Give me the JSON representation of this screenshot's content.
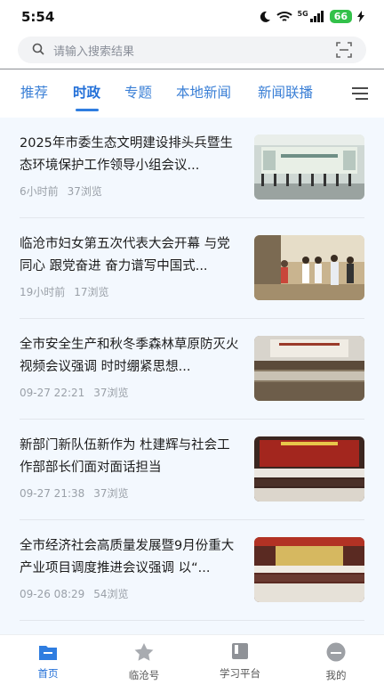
{
  "status": {
    "time": "5:54",
    "network": "5G",
    "battery": "66"
  },
  "search": {
    "placeholder": "请输入搜索结果"
  },
  "tabs": [
    "推荐",
    "时政",
    "专题",
    "本地新闻",
    "新闻联播"
  ],
  "active_tab": "时政",
  "news": [
    {
      "title": "2025年市委生态文明建设排头兵暨生态环境保护工作领导小组会议...",
      "time": "6小时前",
      "views": "37浏览"
    },
    {
      "title": "临沧市妇女第五次代表大会开幕 与党同心 跟党奋进 奋力谱写中国式...",
      "time": "19小时前",
      "views": "17浏览"
    },
    {
      "title": "全市安全生产和秋冬季森林草原防灭火视频会议强调 时时绷紧思想...",
      "time": "09-27 22:21",
      "views": "37浏览"
    },
    {
      "title": "新部门新队伍新作为 杜建辉与社会工作部部长们面对面话担当",
      "time": "09-27 21:38",
      "views": "37浏览"
    },
    {
      "title": "全市经济社会高质量发展暨9月份重大产业项目调度推进会议强调 以“...",
      "time": "09-26 08:29",
      "views": "54浏览"
    }
  ],
  "bottom_nav": [
    "首页",
    "临沧号",
    "学习平台",
    "我的"
  ],
  "colors": {
    "accent": "#2370d8",
    "list_bg": "#f3f8fe"
  }
}
